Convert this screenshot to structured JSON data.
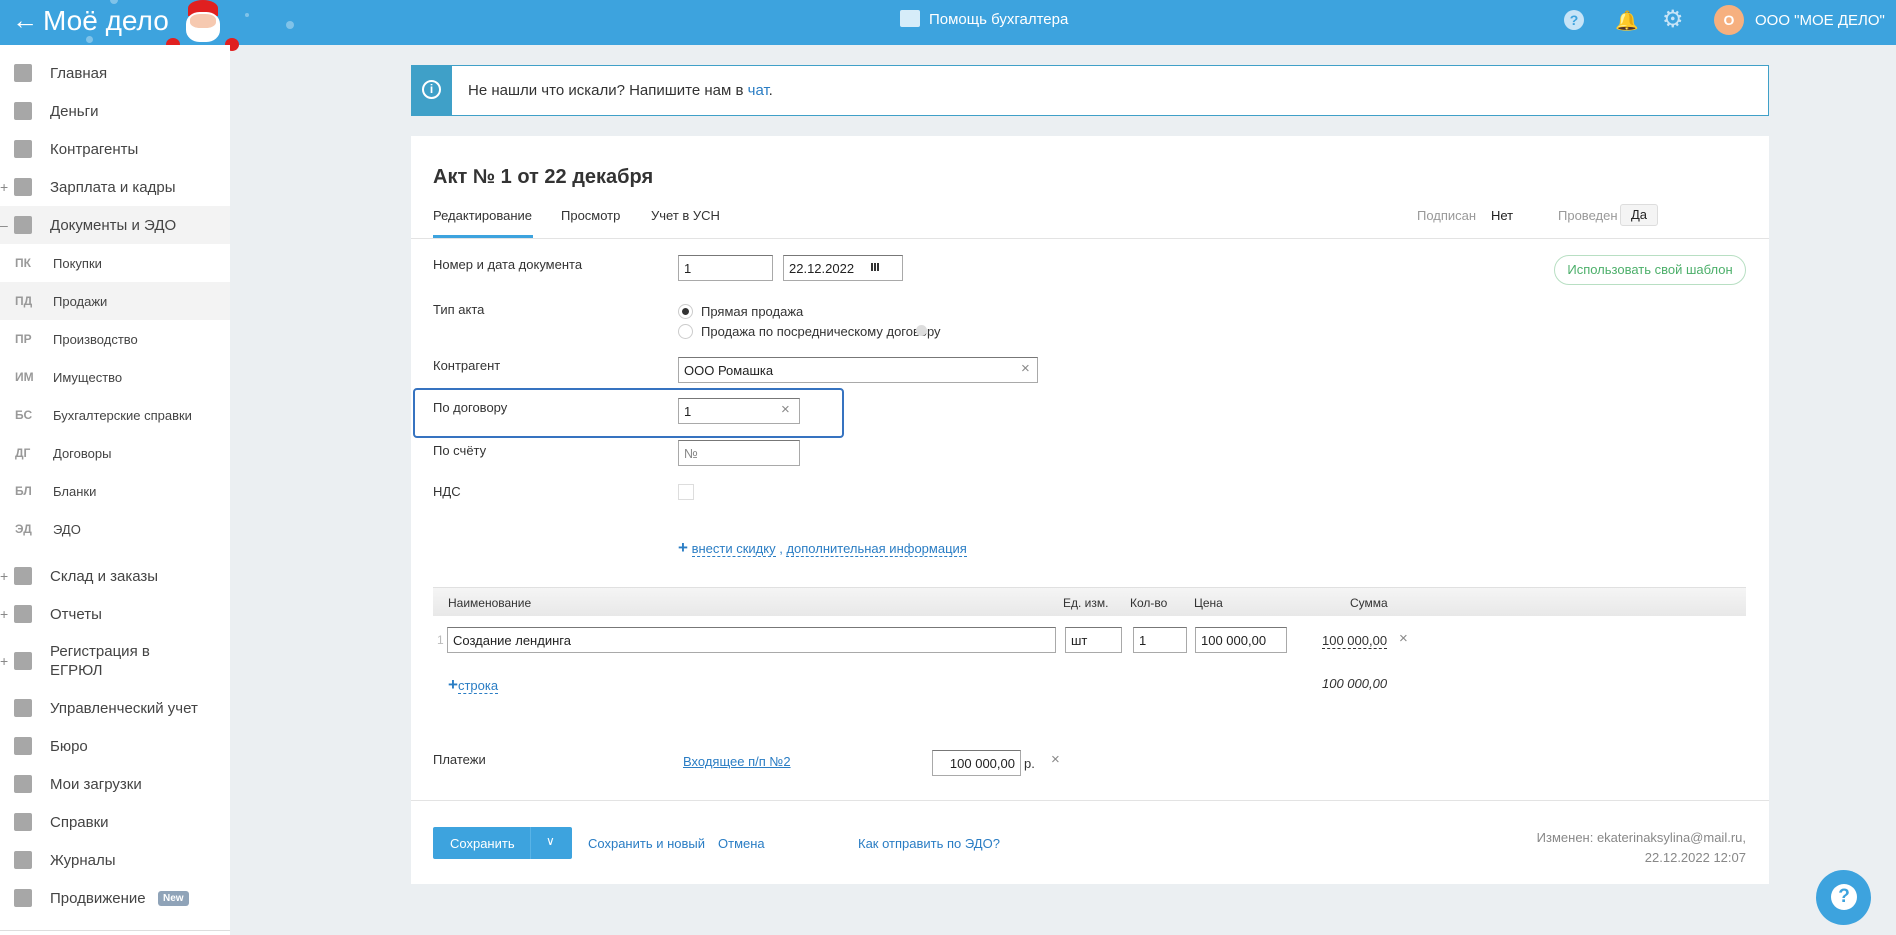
{
  "header": {
    "logo": "Моё дело",
    "center_title": "Помощь бухгалтера",
    "avatar_letter": "О",
    "company": "ООО \"МОЕ ДЕЛО\""
  },
  "sidebar": {
    "items": [
      {
        "label": "Главная",
        "icon": "home-icon",
        "expander": ""
      },
      {
        "label": "Деньги",
        "icon": "money-icon",
        "expander": ""
      },
      {
        "label": "Контрагенты",
        "icon": "person-icon",
        "expander": ""
      },
      {
        "label": "Зарплата и кадры",
        "icon": "wallet-icon",
        "expander": "+"
      },
      {
        "label": "Документы и ЭДО",
        "icon": "folder-icon",
        "expander": "–"
      }
    ],
    "subitems": [
      {
        "abbr": "ПК",
        "label": "Покупки"
      },
      {
        "abbr": "ПД",
        "label": "Продажи"
      },
      {
        "abbr": "ПР",
        "label": "Производство"
      },
      {
        "abbr": "ИМ",
        "label": "Имущество"
      },
      {
        "abbr": "БС",
        "label": "Бухгалтерские справки"
      },
      {
        "abbr": "ДГ",
        "label": "Договоры"
      },
      {
        "abbr": "БЛ",
        "label": "Бланки"
      },
      {
        "abbr": "ЭД",
        "label": "ЭДО"
      }
    ],
    "items2": [
      {
        "label": "Склад и заказы",
        "icon": "warehouse-icon",
        "expander": "+"
      },
      {
        "label": "Отчеты",
        "icon": "report-icon",
        "expander": "+"
      },
      {
        "label": "Регистрация в",
        "label2": "ЕГРЮЛ",
        "icon": "registration-icon",
        "expander": "+"
      },
      {
        "label": "Управленческий учет",
        "icon": "ruble-chart-icon",
        "expander": ""
      },
      {
        "label": "Бюро",
        "icon": "briefcase-icon",
        "expander": ""
      },
      {
        "label": "Мои загрузки",
        "icon": "folder-icon",
        "expander": ""
      },
      {
        "label": "Справки",
        "icon": "certificate-icon",
        "expander": ""
      },
      {
        "label": "Журналы",
        "icon": "journal-icon",
        "expander": ""
      },
      {
        "label": "Продвижение",
        "icon": "promo-icon",
        "expander": "",
        "badge": "New"
      }
    ]
  },
  "banner": {
    "text": "Не нашли что искали? Напишите нам в ",
    "link": "чат",
    "end": "."
  },
  "doc": {
    "title": "Акт № 1 от 22 декабря",
    "tabs": [
      "Редактирование",
      "Просмотр",
      "Учет в УСН"
    ],
    "signed_label": "Подписан",
    "signed_value": "Нет",
    "posted_label": "Проведен",
    "posted_value": "Да",
    "template_button": "Использовать свой шаблон",
    "fields": {
      "num_date_label": "Номер и дата документа",
      "number": "1",
      "date": "22.12.2022",
      "type_label": "Тип акта",
      "type_opt1": "Прямая продажа",
      "type_opt2": "Продажа по посредническому договору",
      "counterparty_label": "Контрагент",
      "counterparty": "ООО Ромашка",
      "contract_label": "По договору",
      "contract": "1",
      "invoice_label": "По счёту",
      "invoice_placeholder": "№",
      "vat_label": "НДС",
      "plus": "+",
      "discount_link": "внести скидку",
      "sep": ",",
      "extra_link": "дополнительная информация"
    },
    "table": {
      "headers": [
        "Наименование",
        "Ед. изм.",
        "Кол-во",
        "Цена",
        "Сумма"
      ],
      "rows": [
        {
          "n": "1",
          "name": "Создание лендинга",
          "unit": "шт",
          "qty": "1",
          "price": "100 000,00",
          "sum": "100 000,00"
        }
      ],
      "add_row": "строка",
      "total": "100 000,00"
    },
    "payments": {
      "label": "Платежи",
      "link": "Входящее п/п №2",
      "amount": "100 000,00",
      "currency": "р."
    },
    "footer": {
      "save": "Сохранить",
      "save_new": "Сохранить и новый",
      "cancel": "Отмена",
      "edo_link": "Как отправить по ЭДО?",
      "changed": "Изменен: ekaterinaksylina@mail.ru,",
      "changed_date": "22.12.2022 12:07"
    }
  }
}
